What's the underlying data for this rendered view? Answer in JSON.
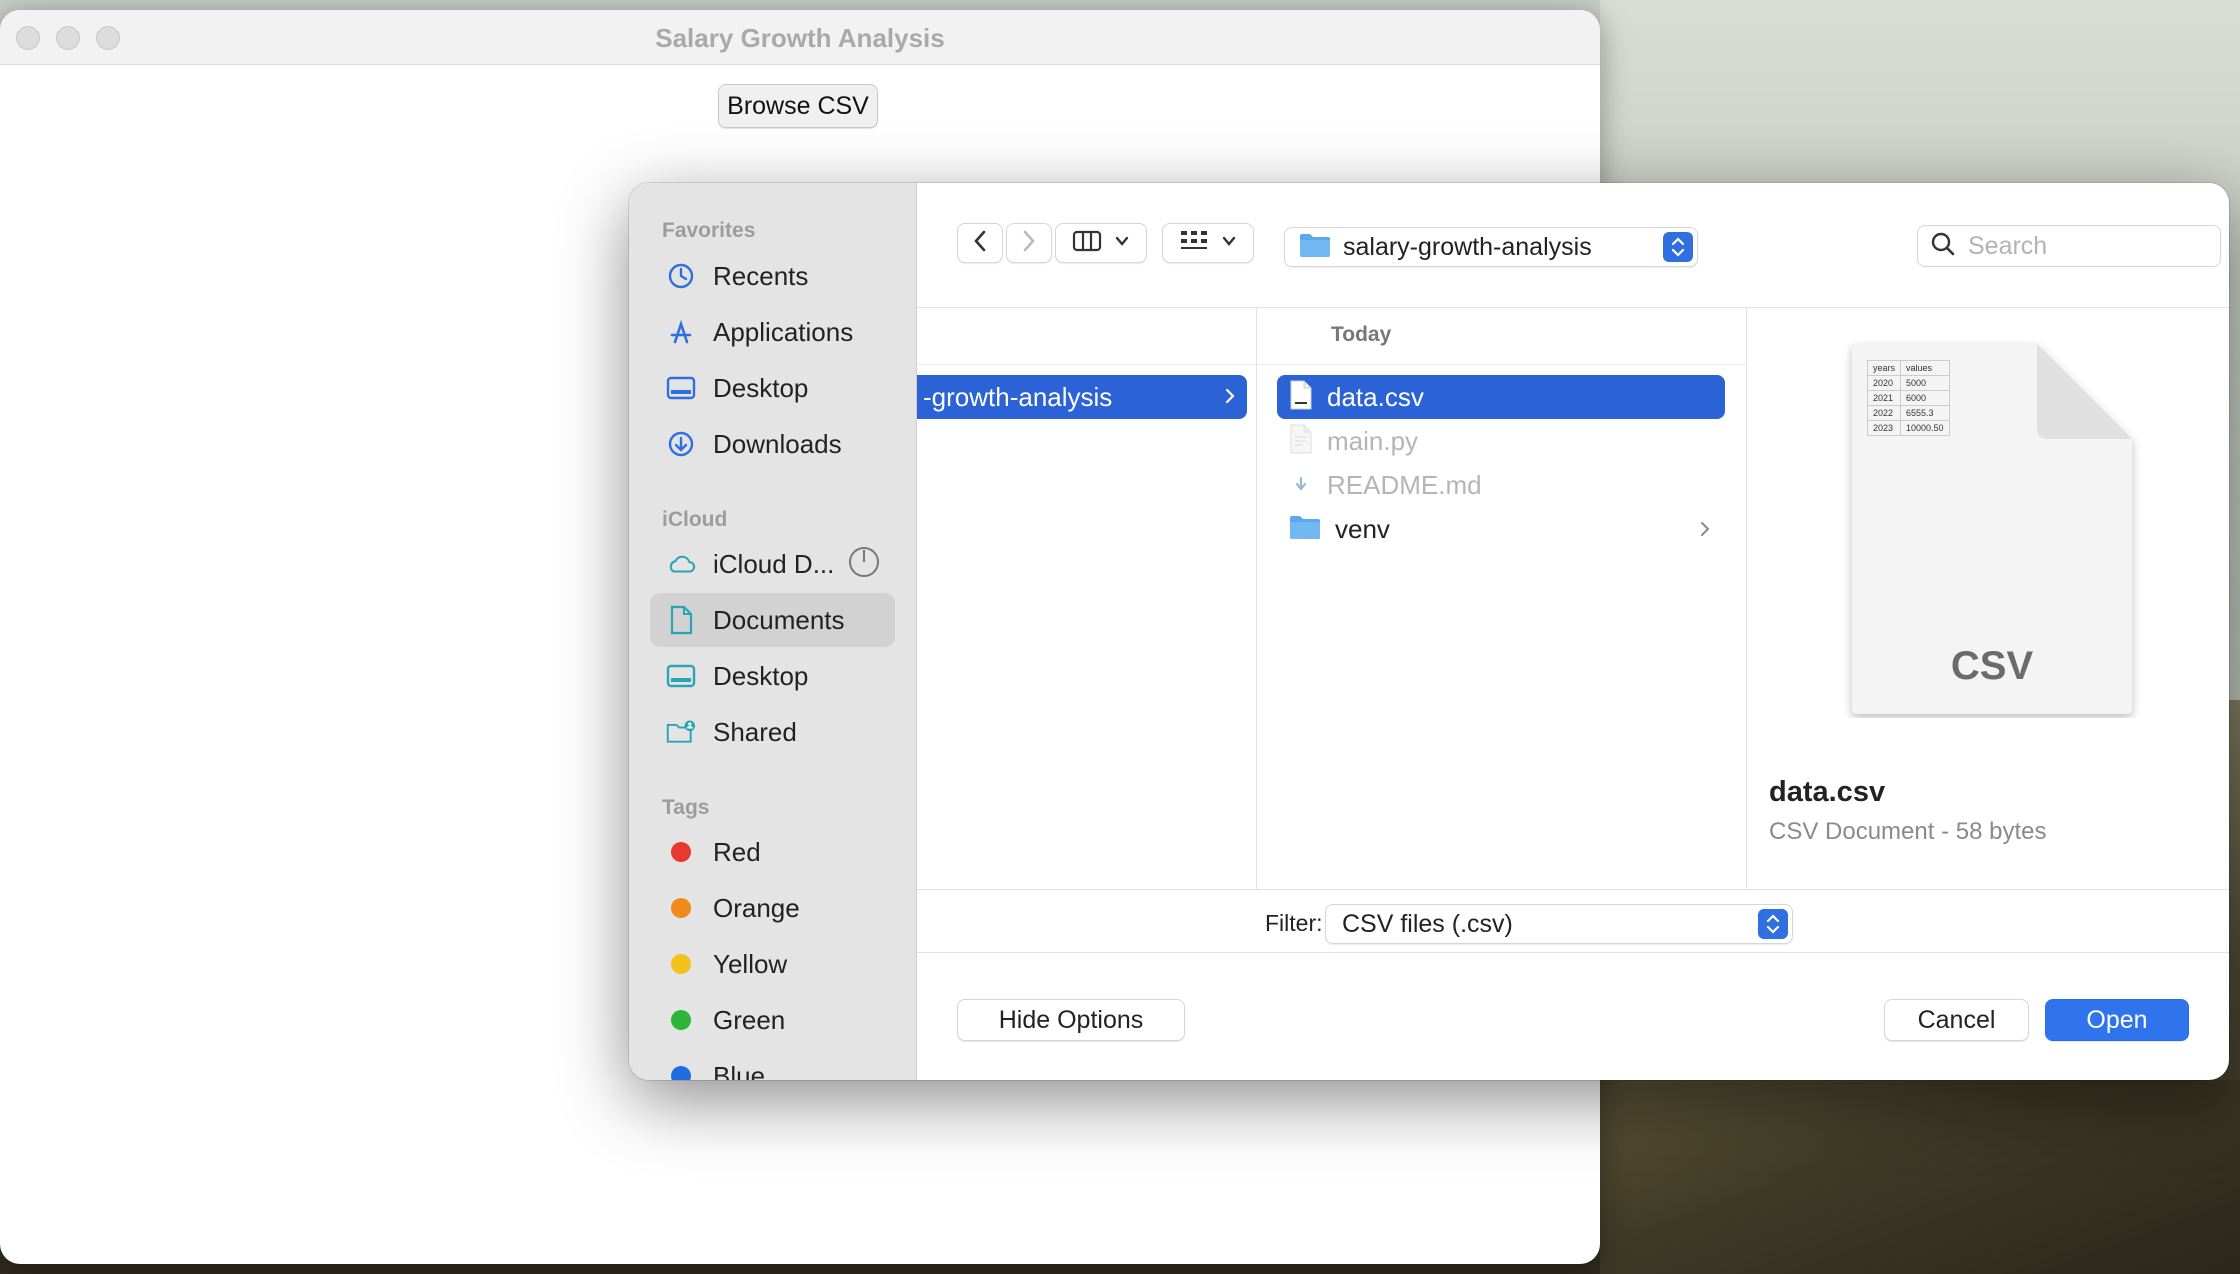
{
  "window": {
    "title": "Salary Growth Analysis",
    "browse_label": "Browse CSV"
  },
  "dialog": {
    "sidebar": {
      "favorites_header": "Favorites",
      "favorites": [
        {
          "label": "Recents",
          "icon": "clock-icon"
        },
        {
          "label": "Applications",
          "icon": "applications-icon"
        },
        {
          "label": "Desktop",
          "icon": "desktop-icon"
        },
        {
          "label": "Downloads",
          "icon": "downloads-icon"
        }
      ],
      "icloud_header": "iCloud",
      "icloud": [
        {
          "label": "iCloud D...",
          "icon": "cloud-icon"
        },
        {
          "label": "Documents",
          "icon": "document-icon",
          "selected": true
        },
        {
          "label": "Desktop",
          "icon": "desktop-icon"
        },
        {
          "label": "Shared",
          "icon": "shared-folder-icon"
        }
      ],
      "tags_header": "Tags",
      "tags": [
        {
          "label": "Red",
          "color": "#e8392f"
        },
        {
          "label": "Orange",
          "color": "#f08a1c"
        },
        {
          "label": "Yellow",
          "color": "#f2c21a"
        },
        {
          "label": "Green",
          "color": "#2fb43a"
        },
        {
          "label": "Blue",
          "color": "#1f6de0"
        }
      ]
    },
    "toolbar": {
      "path_label": "salary-growth-analysis",
      "search_placeholder": "Search"
    },
    "column1": {
      "selected_label": "-growth-analysis"
    },
    "column2": {
      "header": "Today",
      "files": [
        {
          "name": "data.csv",
          "selected": true,
          "type": "csv"
        },
        {
          "name": "main.py",
          "dimmed": true,
          "type": "py"
        },
        {
          "name": "README.md",
          "dimmed": true,
          "type": "md"
        },
        {
          "name": "venv",
          "type": "folder"
        }
      ]
    },
    "preview": {
      "name": "data.csv",
      "meta": "CSV Document - 58 bytes",
      "icon_label": "CSV",
      "table": {
        "headers": [
          "years",
          "values"
        ],
        "rows": [
          [
            "2020",
            "5000"
          ],
          [
            "2021",
            "6000"
          ],
          [
            "2022",
            "6555.3"
          ],
          [
            "2023",
            "10000.50"
          ]
        ]
      }
    },
    "filter": {
      "label": "Filter:",
      "value": "CSV files (.csv)"
    },
    "buttons": {
      "hide_options": "Hide Options",
      "cancel": "Cancel",
      "open": "Open"
    },
    "accent_color": "#2b63d6"
  }
}
